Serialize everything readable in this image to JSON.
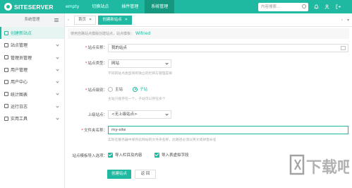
{
  "topbar": {
    "logo": "SITESERVER",
    "nav": [
      "empty",
      "切换站点",
      "插件管理",
      "系统管理"
    ],
    "search_placeholder": "内容搜索..."
  },
  "sidebar": {
    "header": "系统管理",
    "items": [
      "创建新站点",
      "站点管理",
      "管理员管理",
      "用户管理",
      "用户中心",
      "统计图表",
      "运行日志",
      "实用工具"
    ]
  },
  "tabs": {
    "home": "首页",
    "active": "创建新站点"
  },
  "info": {
    "text": "使用自路站点模版创建站点，站点模板：",
    "link": "Wifried"
  },
  "form": {
    "site_name_label": "站点名称",
    "site_name_value": "我的站点",
    "site_type_label": "站点类型",
    "site_type_value": "网站",
    "site_type_hint": "不同的站点类型将有独立的栏目与管理菜单",
    "site_level_label": "站点级别",
    "level_main": "主站",
    "level_sub": "子站",
    "site_level_hint": "主站只能存在一个，子站可以存在多个",
    "parent_label": "上级站点",
    "parent_value": "<无上级站点>",
    "dir_label": "文件夹名称",
    "dir_value": "my-site",
    "dir_hint": "实际在服务器中保存此网站的文件夹名称，此路径必须以英文或拼音命名",
    "import_label": "站点模板导入选项",
    "import_opt1": "导入栏目及内容",
    "import_opt2": "导入表虚拟字段"
  },
  "buttons": {
    "create": "创建站点",
    "back": "返 回"
  },
  "watermark": "下载吧",
  "colors": {
    "accent": "#1fb8a0",
    "accent_dark": "#16977f"
  }
}
